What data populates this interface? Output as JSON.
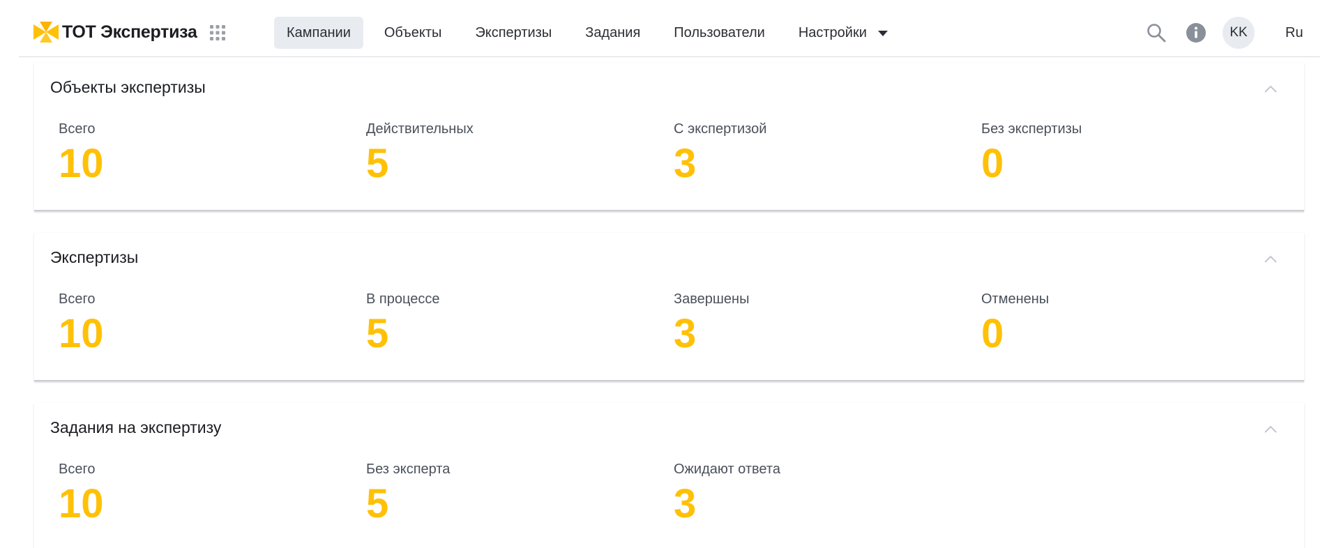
{
  "header": {
    "logo_text": "ТОТ Экспертиза",
    "nav": [
      {
        "label": "Кампании",
        "active": true
      },
      {
        "label": "Объекты",
        "active": false
      },
      {
        "label": "Экспертизы",
        "active": false
      },
      {
        "label": "Задания",
        "active": false
      },
      {
        "label": "Пользователи",
        "active": false
      },
      {
        "label": "Настройки",
        "active": false,
        "has_dropdown": true
      }
    ],
    "avatar_initials": "KK",
    "language": "Ru",
    "icons": [
      "apps-grid-icon",
      "search-icon",
      "info-icon",
      "chevron-down-icon"
    ]
  },
  "cards": [
    {
      "title": "Объекты экспертизы",
      "stats": [
        {
          "label": "Всего",
          "value": "10"
        },
        {
          "label": "Действительных",
          "value": "5"
        },
        {
          "label": "С экспертизой",
          "value": "3"
        },
        {
          "label": "Без экспертизы",
          "value": "0"
        }
      ]
    },
    {
      "title": "Экспертизы",
      "stats": [
        {
          "label": "Всего",
          "value": "10"
        },
        {
          "label": "В процессе",
          "value": "5"
        },
        {
          "label": "Завершены",
          "value": "3"
        },
        {
          "label": "Отменены",
          "value": "0"
        }
      ]
    },
    {
      "title": "Задания на экспертизу",
      "stats": [
        {
          "label": "Всего",
          "value": "10"
        },
        {
          "label": "Без эксперта",
          "value": "5"
        },
        {
          "label": "Ожидают ответа",
          "value": "3"
        }
      ]
    }
  ],
  "colors": {
    "accent_yellow": "#ffc107",
    "nav_active_bg": "#e8ebf0",
    "text_primary": "#1b1d21",
    "text_secondary": "#4a505a"
  }
}
